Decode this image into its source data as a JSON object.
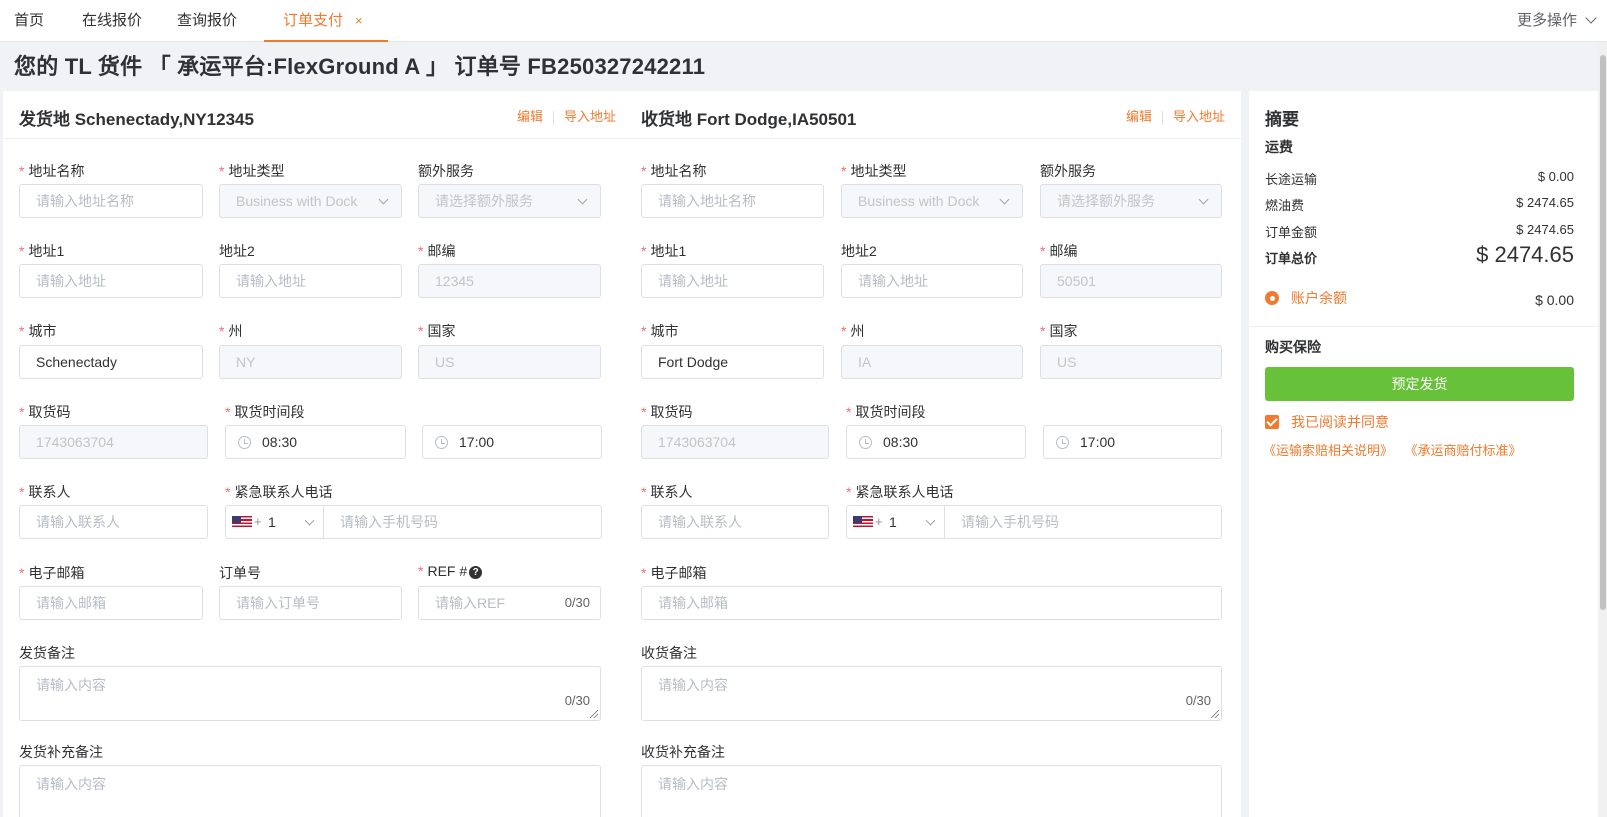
{
  "tabs": [
    {
      "label": "首页"
    },
    {
      "label": "在线报价"
    },
    {
      "label": "查询报价"
    },
    {
      "label": "订单支付",
      "close": "×"
    }
  ],
  "more_ops": "更多操作",
  "page_title": "您的 TL 货件 「 承运平台:FlexGround A 」 订单号 FB250327242211",
  "shipper": {
    "title": "发货地 Schenectady,NY12345",
    "edit": "编辑",
    "import": "导入地址",
    "labels": {
      "addr_name": "地址名称",
      "addr_type": "地址类型",
      "extra": "额外服务",
      "addr1": "地址1",
      "addr2": "地址2",
      "zip": "邮编",
      "city": "城市",
      "state": "州",
      "country": "国家",
      "pickup_code": "取货码",
      "pickup_window": "取货时间段",
      "contact": "联系人",
      "emergency_phone": "紧急联系人电话",
      "email": "电子邮箱",
      "order_no": "订单号",
      "ref": "REF #",
      "remark": "发货备注",
      "remark2": "发货补充备注"
    },
    "placeholders": {
      "addr_name": "请输入地址名称",
      "extra": "请选择额外服务",
      "addr1": "请输入地址",
      "addr2": "请输入地址",
      "contact": "请输入联系人",
      "phone": "请输入手机号码",
      "email": "请输入邮箱",
      "order_no": "请输入订单号",
      "ref": "请输入REF",
      "remark": "请输入内容",
      "remark2": "请输入内容"
    },
    "values": {
      "addr_type": "Business with Dock",
      "zip": "12345",
      "city": "Schenectady",
      "state": "NY",
      "country": "US",
      "pickup_code": "1743063704",
      "time_start": "08:30",
      "time_end": "17:00",
      "phone_plus": "+",
      "phone_code": "1",
      "ref_count": "0/30",
      "remark_count": "0/30"
    },
    "help": "?"
  },
  "consignee": {
    "title": "收货地 Fort Dodge,IA50501",
    "edit": "编辑",
    "import": "导入地址",
    "labels": {
      "addr_name": "地址名称",
      "addr_type": "地址类型",
      "extra": "额外服务",
      "addr1": "地址1",
      "addr2": "地址2",
      "zip": "邮编",
      "city": "城市",
      "state": "州",
      "country": "国家",
      "pickup_code": "取货码",
      "pickup_window": "取货时间段",
      "contact": "联系人",
      "emergency_phone": "紧急联系人电话",
      "email": "电子邮箱",
      "remark": "收货备注",
      "remark2": "收货补充备注"
    },
    "placeholders": {
      "addr_name": "请输入地址名称",
      "extra": "请选择额外服务",
      "addr1": "请输入地址",
      "addr2": "请输入地址",
      "contact": "请输入联系人",
      "phone": "请输入手机号码",
      "email": "请输入邮箱",
      "remark": "请输入内容",
      "remark2": "请输入内容"
    },
    "values": {
      "addr_type": "Business with Dock",
      "zip": "50501",
      "city": "Fort Dodge",
      "state": "IA",
      "country": "US",
      "pickup_code": "1743063704",
      "time_start": "08:30",
      "time_end": "17:00",
      "phone_plus": "+",
      "phone_code": "1",
      "remark_count": "0/30"
    }
  },
  "summary": {
    "title": "摘要",
    "freight": "运费",
    "rows": [
      {
        "label": "长途运输",
        "value": "$ 0.00"
      },
      {
        "label": "燃油费",
        "value": "$ 2474.65"
      },
      {
        "label": "订单金额",
        "value": "$ 2474.65"
      }
    ],
    "total_label": "订单总价",
    "total_value": "$ 2474.65",
    "balance_label": "账户余额",
    "balance_value": "$ 0.00",
    "insurance": "购买保险",
    "book_button": "预定发货",
    "agree": "我已阅读并同意",
    "link1": "《运输索赔相关说明》",
    "link2": "《承运商赔付标准》"
  },
  "colors": {
    "accent": "#f07a2e",
    "green": "#67c23a",
    "required": "#f56c6c"
  }
}
